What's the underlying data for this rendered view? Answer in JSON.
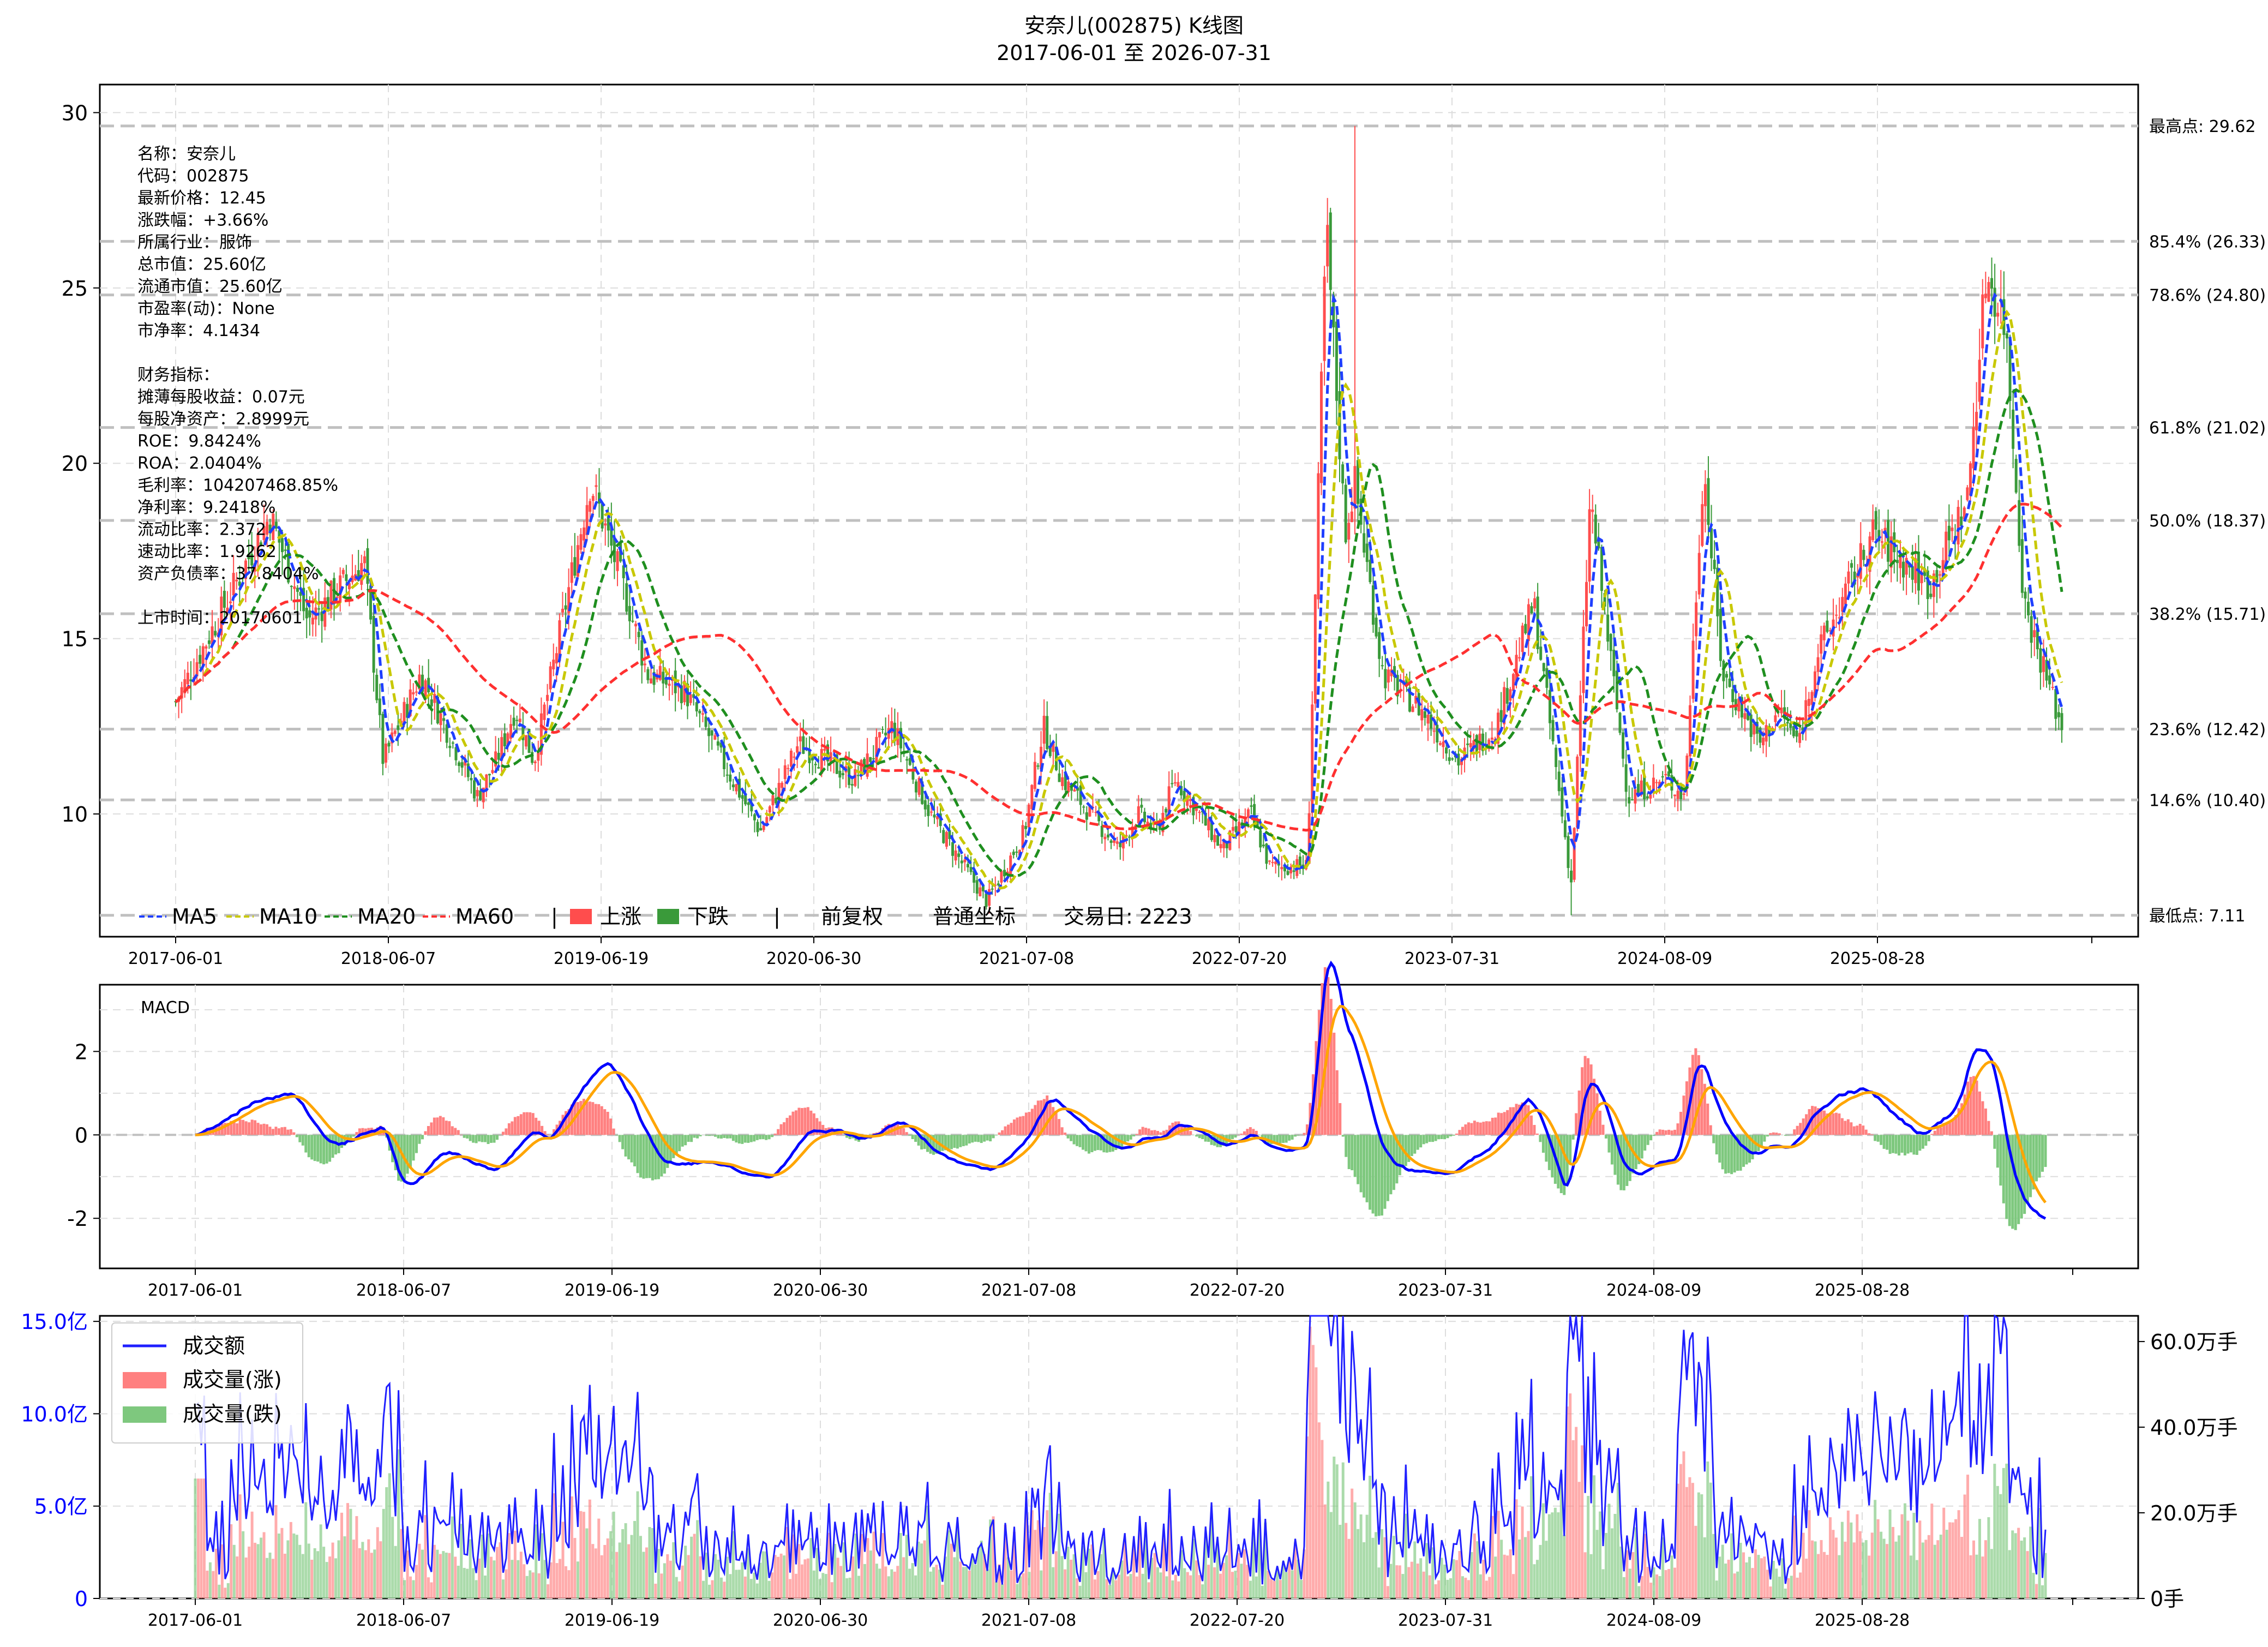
{
  "title": "安奈儿(002875) K线图",
  "subtitle": "2017-06-01 至 2026-07-31",
  "colors": {
    "up": "#ff4d4d",
    "down": "#3a9a3a",
    "ma5": "#1f3fff",
    "ma10": "#c8c800",
    "ma20": "#1f8f1f",
    "ma60": "#ff3030",
    "amount": "#2020ff",
    "dif": "#0000ff",
    "dea": "#ffa500"
  },
  "info_lines": [
    "名称：安奈儿",
    "代码：002875",
    "最新价格：12.45",
    "涨跌幅：+3.66%",
    "所属行业：服饰",
    "总市值：25.60亿",
    "流通市值：25.60亿",
    "市盈率(动)：None",
    "市净率：4.1434",
    "",
    "财务指标：",
    "摊薄每股收益：0.07元",
    "每股净资产：2.8999元",
    "ROE：9.8424%",
    "ROA：2.0404%",
    "毛利率：104207468.85%",
    "净利率：9.2418%",
    "流动比率：2.372",
    "速动比率：1.9262",
    "资产负债率：37.8404%",
    "",
    "上市时间：20170601"
  ],
  "legend": {
    "ma5": "MA5",
    "ma10": "MA10",
    "ma20": "MA20",
    "ma60": "MA60",
    "up": "上涨",
    "down": "下跌",
    "sep": "|",
    "adjust": "前复权",
    "scale": "普通坐标",
    "days": "交易日: 2223"
  },
  "fib_levels": [
    {
      "label": "最高点: 29.62",
      "value": 29.62
    },
    {
      "label": "85.4% (26.33)",
      "value": 26.33
    },
    {
      "label": "78.6% (24.80)",
      "value": 24.8
    },
    {
      "label": "61.8% (21.02)",
      "value": 21.02
    },
    {
      "label": "50.0% (18.37)",
      "value": 18.37
    },
    {
      "label": "38.2% (15.71)",
      "value": 15.71
    },
    {
      "label": "23.6% (12.42)",
      "value": 12.42
    },
    {
      "label": "14.6% (10.40)",
      "value": 10.4
    },
    {
      "label": "最低点: 7.11",
      "value": 7.11
    }
  ],
  "x_ticks": [
    "2017-06-01",
    "2018-06-07",
    "2019-06-19",
    "2020-06-30",
    "2021-07-08",
    "2022-07-20",
    "2023-07-31",
    "2024-08-09",
    "2025-08-28"
  ],
  "price_ticks": [
    10,
    15,
    20,
    25,
    30
  ],
  "macd_label": "MACD",
  "macd_ticks": [
    -2,
    0,
    2
  ],
  "vol_legend": {
    "amount": "成交额",
    "vol_up": "成交量(涨)",
    "vol_down": "成交量(跌)"
  },
  "amount_ticks": [
    {
      "v": 0,
      "label": "0"
    },
    {
      "v": 5,
      "label": "5.0亿"
    },
    {
      "v": 10,
      "label": "10.0亿"
    },
    {
      "v": 15,
      "label": "15.0亿"
    }
  ],
  "volume_ticks": [
    {
      "v": 0,
      "label": "0手"
    },
    {
      "v": 20,
      "label": "20.0万手"
    },
    {
      "v": 40,
      "label": "40.0万手"
    },
    {
      "v": 60,
      "label": "60.0万手"
    }
  ],
  "chart_data": {
    "type": "line",
    "title": "安奈儿(002875) K线图",
    "subtitle": "2017-06-01 至 2026-07-31",
    "price_ylim": [
      6.5,
      30.8
    ],
    "price_close_approx": {
      "t": [
        0,
        0.05,
        0.07,
        0.1,
        0.11,
        0.13,
        0.16,
        0.17,
        0.18,
        0.19,
        0.22,
        0.24,
        0.25,
        0.27,
        0.28,
        0.31,
        0.33,
        0.36,
        0.38,
        0.4,
        0.43,
        0.45,
        0.46,
        0.47,
        0.5,
        0.51,
        0.52,
        0.53,
        0.555,
        0.57,
        0.58,
        0.6,
        0.61,
        0.62,
        0.625,
        0.64,
        0.66,
        0.68,
        0.7,
        0.72,
        0.74,
        0.75,
        0.77,
        0.79,
        0.8,
        0.81,
        0.82,
        0.84,
        0.85,
        0.86,
        0.87,
        0.9,
        0.93,
        0.95,
        0.96,
        0.97,
        0.98,
        1.0
      ],
      "close": [
        13.2,
        18.5,
        15.5,
        17.2,
        11.5,
        14.0,
        10.5,
        11.5,
        13.0,
        11.5,
        19.5,
        16.0,
        14.0,
        13.5,
        12.5,
        9.5,
        12.0,
        11.0,
        12.5,
        10.0,
        7.5,
        9.5,
        12.5,
        11.0,
        9.0,
        10.0,
        9.5,
        11.0,
        9.0,
        10.0,
        8.5,
        8.5,
        26.8,
        18.0,
        19.5,
        14.0,
        13.0,
        11.5,
        12.5,
        16.0,
        8.0,
        19.0,
        10.5,
        11.0,
        10.5,
        20.0,
        14.0,
        12.0,
        13.0,
        12.0,
        14.5,
        18.0,
        16.5,
        19.0,
        25.5,
        24.0,
        16.0,
        12.45
      ]
    },
    "macd_ylim": [
      -3.2,
      3.6
    ],
    "amount_ylim_yi": [
      0,
      15.3
    ],
    "volume_ylim_wanshou": [
      0,
      66
    ]
  }
}
